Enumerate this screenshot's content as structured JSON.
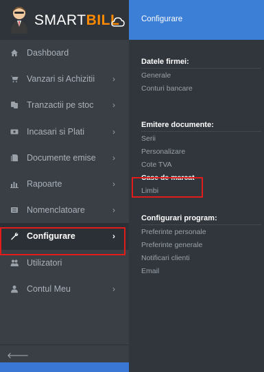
{
  "brand": {
    "smart": "SMART",
    "bill": "BILL"
  },
  "sidebar": {
    "items": [
      {
        "label": "Dashboard",
        "icon": "home-icon",
        "has_submenu": false
      },
      {
        "label": "Vanzari si Achizitii",
        "icon": "cart-icon",
        "has_submenu": true
      },
      {
        "label": "Tranzactii pe stoc",
        "icon": "stock-icon",
        "has_submenu": true
      },
      {
        "label": "Incasari si Plati",
        "icon": "money-icon",
        "has_submenu": true
      },
      {
        "label": "Documente emise",
        "icon": "documents-icon",
        "has_submenu": true
      },
      {
        "label": "Rapoarte",
        "icon": "bar-chart-icon",
        "has_submenu": true
      },
      {
        "label": "Nomenclatoare",
        "icon": "list-icon",
        "has_submenu": true
      },
      {
        "label": "Configurare",
        "icon": "wrench-icon",
        "has_submenu": true,
        "active": true
      },
      {
        "label": "Utilizatori",
        "icon": "users-icon",
        "has_submenu": false
      },
      {
        "label": "Contul Meu",
        "icon": "user-icon",
        "has_submenu": true
      }
    ],
    "collapse_icon": "arrow-left-icon",
    "chevron": "›",
    "collapse_glyph": "🡐"
  },
  "submenu": {
    "title": "Configurare",
    "sections": [
      {
        "title": "Datele firmei:",
        "links": [
          "Generale",
          "Conturi bancare"
        ]
      },
      {
        "title": "Emitere documente:",
        "links": [
          "Serii",
          "Personalizare",
          "Cote TVA",
          "Case de marcat",
          "Limbi"
        ]
      },
      {
        "title": "Configurari program:",
        "links": [
          "Preferinte personale",
          "Preferinte generale",
          "Notificari clienti",
          "Email"
        ]
      }
    ],
    "selected_link": "Case de marcat"
  },
  "colors": {
    "sidebar_bg": "#3a3f46",
    "panel_bg": "#31363c",
    "header_blue": "#3c7fd6",
    "brand_orange": "#ff8a00",
    "highlight_red": "#e21b1b"
  }
}
